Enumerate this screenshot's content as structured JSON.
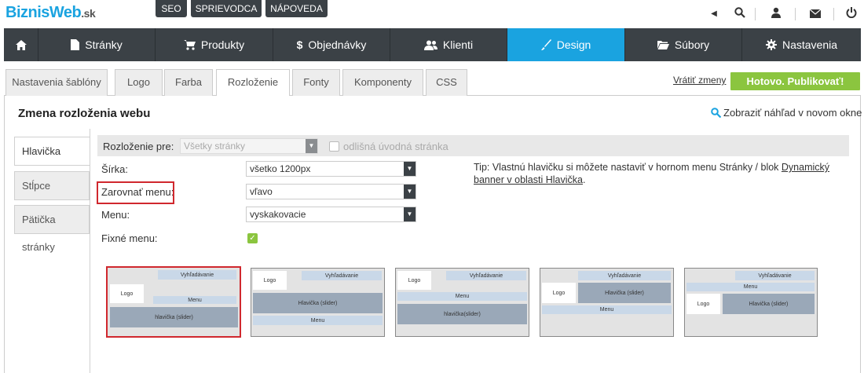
{
  "brand": {
    "name1": "Biznis",
    "name2": "Web",
    "suffix": ".sk"
  },
  "top_links": [
    "SEO",
    "SPRIEVODCA",
    "NÁPOVEDA"
  ],
  "main_nav": [
    {
      "label": "",
      "icon": "home-icon"
    },
    {
      "label": "Stránky",
      "icon": "page-icon"
    },
    {
      "label": "Produkty",
      "icon": "cart-icon"
    },
    {
      "label": "Objednávky",
      "icon": "dollar-icon"
    },
    {
      "label": "Klienti",
      "icon": "users-icon"
    },
    {
      "label": "Design",
      "icon": "brush-icon",
      "active": true
    },
    {
      "label": "Súbory",
      "icon": "folder-icon"
    },
    {
      "label": "Nastavenia",
      "icon": "gear-icon"
    }
  ],
  "sub_tabs": [
    "Nastavenia šablóny",
    "Logo",
    "Farba",
    "Rozloženie",
    "Fonty",
    "Komponenty",
    "CSS"
  ],
  "active_sub_tab": "Rozloženie",
  "revert_label": "Vrátiť zmeny",
  "publish_label": "Hotovo. Publikovať!",
  "panel_title": "Zmena rozloženia webu",
  "preview_link": "Zobraziť náhľad v novom okne",
  "side_tabs": [
    "Hlavička",
    "Stĺpce",
    "Pätička stránky"
  ],
  "layout_for": {
    "label": "Rozloženie pre:",
    "value": "Všetky stránky",
    "checkbox_label": "odlišná úvodná stránka"
  },
  "fields": {
    "width": {
      "label": "Šírka:",
      "value": "všetko 1200px"
    },
    "align": {
      "label": "Zarovnať menu:",
      "value": "vľavo"
    },
    "menu": {
      "label": "Menu:",
      "value": "vyskakovacie"
    },
    "fixed": {
      "label": "Fixné menu:",
      "checked": true
    }
  },
  "tip": {
    "text": "Tip: Vlastnú hlavičku si môžete nastaviť v hornom menu Stránky / blok ",
    "link": "Dynamický banner v oblasti Hlavička",
    "end": "."
  },
  "layouts": {
    "search": "Vyhľadávanie",
    "logo": "Logo",
    "menu": "Menu",
    "header1": "hlavička (slider)",
    "header2": "Hlavička (slider)",
    "header3": "hlavička(slider)"
  },
  "colors": {
    "accent": "#1aa3e0",
    "nav_bg": "#3b4146",
    "publish": "#8bc53f",
    "highlight": "#d0282e"
  }
}
